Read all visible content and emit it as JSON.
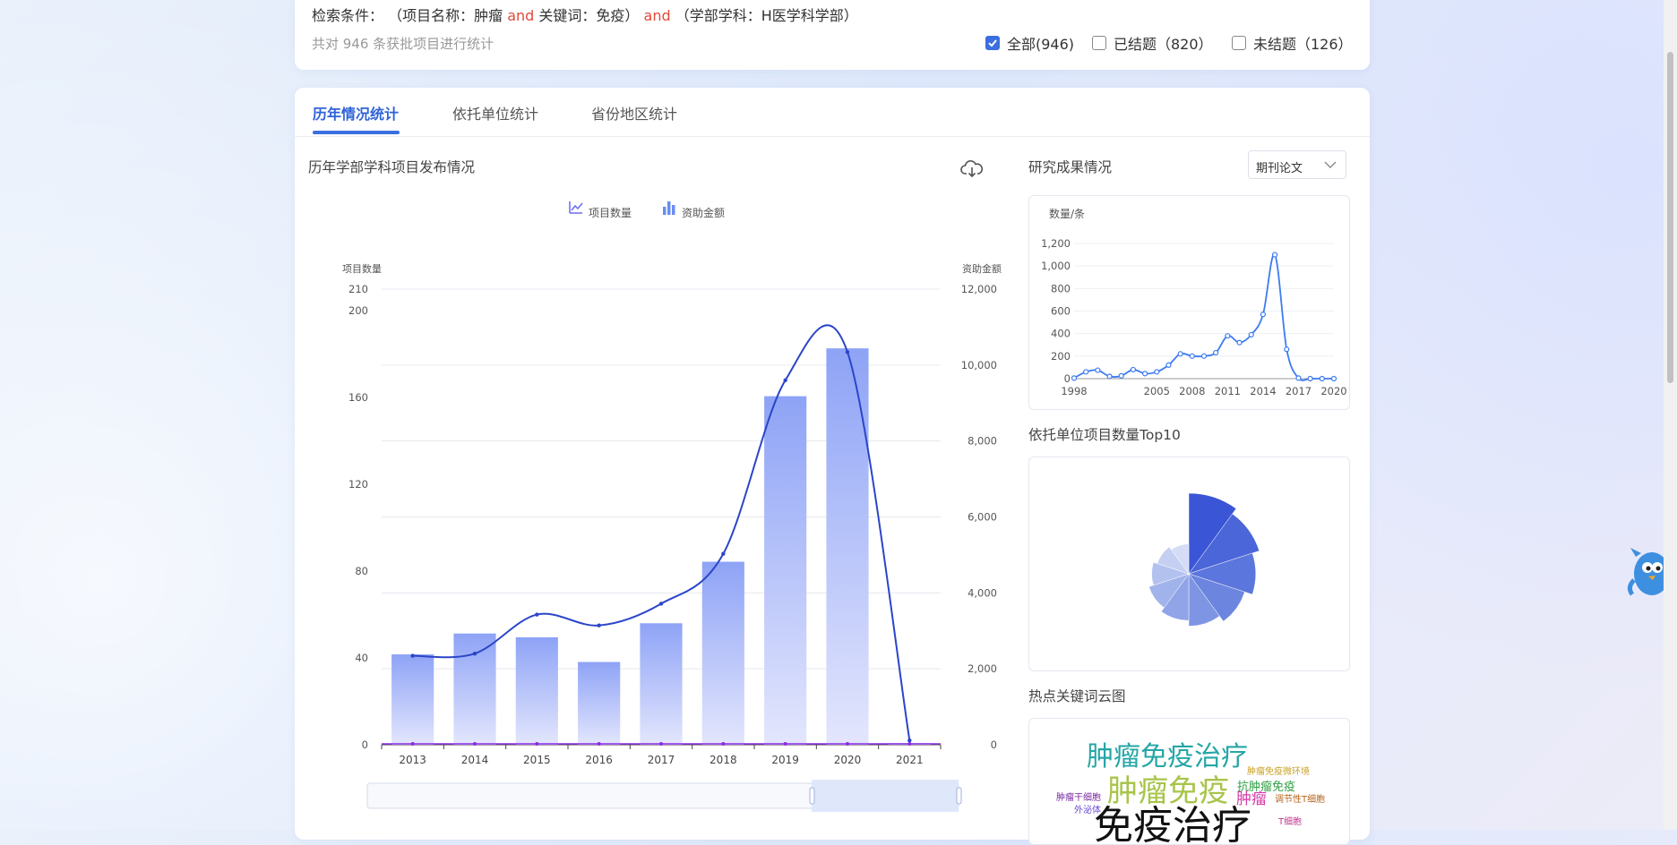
{
  "search": {
    "label": "检索条件：",
    "cond1": "（项目名称：肿瘤",
    "and1": "and",
    "cond2": "关键词：免疫）",
    "and2": "and",
    "cond3": "（学部学科：H医学科学部）",
    "count_text": "共对 946 条获批项目进行统计",
    "filters": [
      {
        "label": "全部(946)",
        "checked": true
      },
      {
        "label": "已结题（820）",
        "checked": false
      },
      {
        "label": "未结题（126）",
        "checked": false
      }
    ]
  },
  "tabs": [
    {
      "label": "历年情况统计",
      "active": true
    },
    {
      "label": "依托单位统计",
      "active": false
    },
    {
      "label": "省份地区统计",
      "active": false
    }
  ],
  "main_chart": {
    "title": "历年学部学科项目发布情况",
    "download_icon": "cloud-download-icon",
    "legend": [
      {
        "name": "项目数量",
        "icon": "line-chart-icon"
      },
      {
        "name": "资助金额",
        "icon": "bar-chart-icon"
      }
    ]
  },
  "side": {
    "results_title": "研究成果情况",
    "results_select": "期刊论文",
    "top10_title": "依托单位项目数量Top10",
    "wordcloud_title": "热点关键词云图",
    "words": [
      {
        "text": "肿瘤免疫治疗",
        "color": "#26a6a6"
      },
      {
        "text": "肿瘤免疫微环境",
        "color": "#c9a227"
      },
      {
        "text": "抗肿瘤免疫",
        "color": "#2f9e44"
      },
      {
        "text": "肿瘤免疫",
        "color": "#a8c44a"
      },
      {
        "text": "肿瘤",
        "color": "#d63ca6"
      },
      {
        "text": "肿瘤干细胞",
        "color": "#7a2aa0"
      },
      {
        "text": "调节性T细胞",
        "color": "#b5651d"
      },
      {
        "text": "外泌体",
        "color": "#6a4cd1"
      },
      {
        "text": "T细胞",
        "color": "#c0398f"
      },
      {
        "text": "免疫治疗",
        "color": "#111111"
      }
    ]
  },
  "chart_data": [
    {
      "type": "bar",
      "title": "历年学部学科项目发布情况",
      "categories": [
        "2013",
        "2014",
        "2015",
        "2016",
        "2017",
        "2018",
        "2019",
        "2020",
        "2021"
      ],
      "series": [
        {
          "name": "项目数量",
          "type": "line",
          "axis": "left",
          "values": [
            41,
            42,
            60,
            55,
            65,
            88,
            168,
            181,
            2
          ]
        },
        {
          "name": "资助金额",
          "type": "bar",
          "axis": "right",
          "values": [
            2380,
            2930,
            2830,
            2180,
            3200,
            4820,
            9180,
            10440,
            40
          ]
        }
      ],
      "ylabel_left": "项目数量",
      "ylabel_right": "资助金额",
      "yticks_left": [
        0,
        40,
        80,
        120,
        160,
        200,
        210
      ],
      "yticks_right": [
        0,
        2000,
        4000,
        6000,
        8000,
        10000,
        12000
      ],
      "ylim_left": [
        0,
        210
      ],
      "ylim_right": [
        0,
        12000
      ],
      "legend": "top-center",
      "grid": true
    },
    {
      "type": "line",
      "title": "研究成果情况",
      "ylabel": "数量/条",
      "x": [
        1998,
        1999,
        2000,
        2001,
        2002,
        2003,
        2004,
        2005,
        2006,
        2007,
        2008,
        2009,
        2010,
        2011,
        2012,
        2013,
        2014,
        2015,
        2016,
        2017,
        2018,
        2019,
        2020
      ],
      "xticks": [
        "1998",
        "2005",
        "2008",
        "2011",
        "2014",
        "2017",
        "2020"
      ],
      "values": [
        5,
        60,
        75,
        20,
        25,
        80,
        45,
        60,
        120,
        220,
        200,
        200,
        230,
        380,
        320,
        390,
        570,
        1100,
        260,
        5,
        0,
        0,
        0
      ],
      "yticks": [
        0,
        200,
        400,
        600,
        800,
        1000,
        1200
      ],
      "ylim": [
        0,
        1200
      ],
      "grid": true
    },
    {
      "type": "pie",
      "title": "依托单位项目数量Top10",
      "values": [
        100,
        92,
        83,
        73,
        65,
        58,
        52,
        46,
        41,
        37
      ],
      "colors": [
        "#3a55d6",
        "#4a66d8",
        "#5b76dc",
        "#6c85df",
        "#7e95e3",
        "#90a4e7",
        "#a1b3eb",
        "#b3c1ee",
        "#c4cff2",
        "#d5ddf6"
      ]
    }
  ]
}
